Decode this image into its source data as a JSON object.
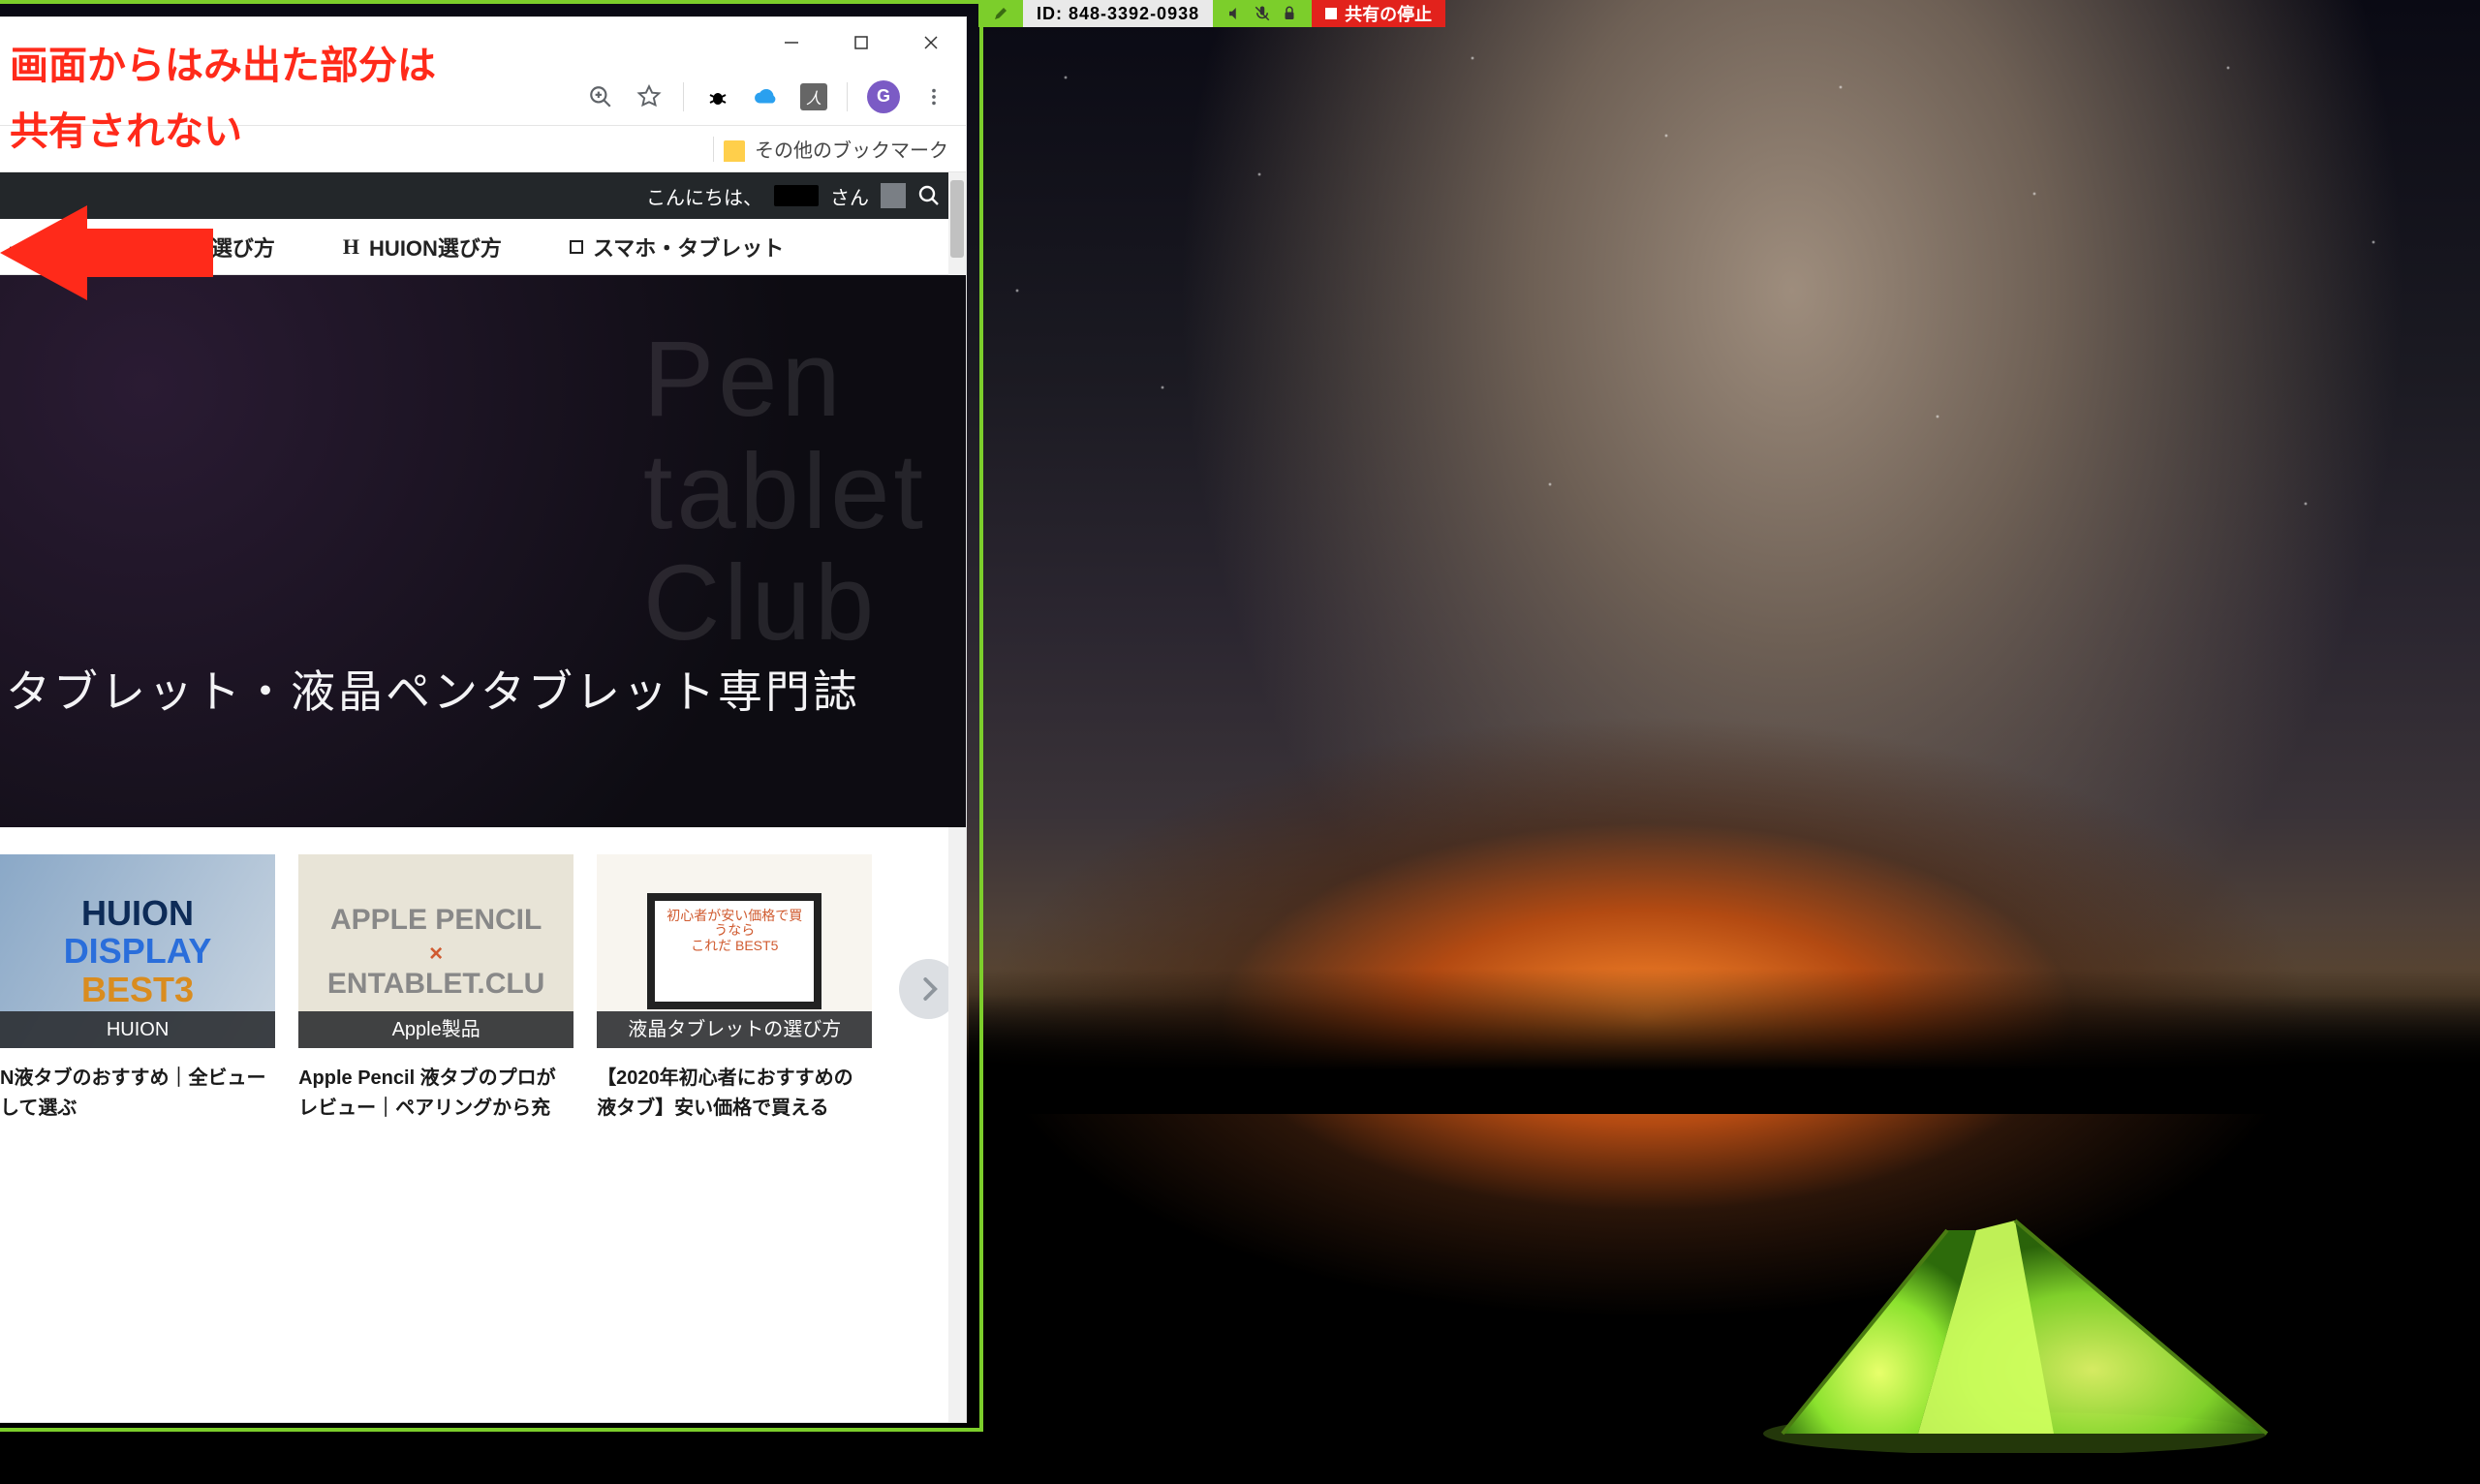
{
  "sharebar": {
    "id_label": "ID: 848-3392-0938",
    "stop_label": "共有の停止"
  },
  "annotation": {
    "line1": "画面からはみ出た部分は",
    "line2": "共有されない"
  },
  "bookmarkbar": {
    "other": "その他のブックマーク"
  },
  "toolbar": {
    "avatar_letter": "G"
  },
  "blackbar": {
    "greeting_prefix": "こんにちは、",
    "greeting_suffix": "さん"
  },
  "menubar": {
    "dash": "―",
    "xp_pen": "XP-PEN選び方",
    "huion": "HUION選び方",
    "smartphone": "スマホ・タブレット"
  },
  "hero": {
    "watermark_l1": "Pen",
    "watermark_l2": "tablet",
    "watermark_l3": "Club",
    "tagline": "タブレット・液晶ペンタブレット専門誌"
  },
  "cards": [
    {
      "thumb_line1": "HUION",
      "thumb_line2": "DISPLAY",
      "thumb_line3": "BEST3",
      "badge": "HUION",
      "caption": "N液タブのおすすめ｜全ビューして選ぶ"
    },
    {
      "thumb_line1": "APPLE PENCIL",
      "thumb_cross": "×",
      "thumb_line2": "ENTABLET.CLU",
      "badge": "Apple製品",
      "caption": "Apple Pencil 液タブのプロがレビュー｜ペアリングから充"
    },
    {
      "thumb_line1": "初心者が安い価格で買うなら",
      "thumb_line2": "これだ BEST5",
      "badge": "液晶タブレットの選び方",
      "caption": "【2020年初心者におすすめの液タブ】安い価格で買える"
    }
  ]
}
